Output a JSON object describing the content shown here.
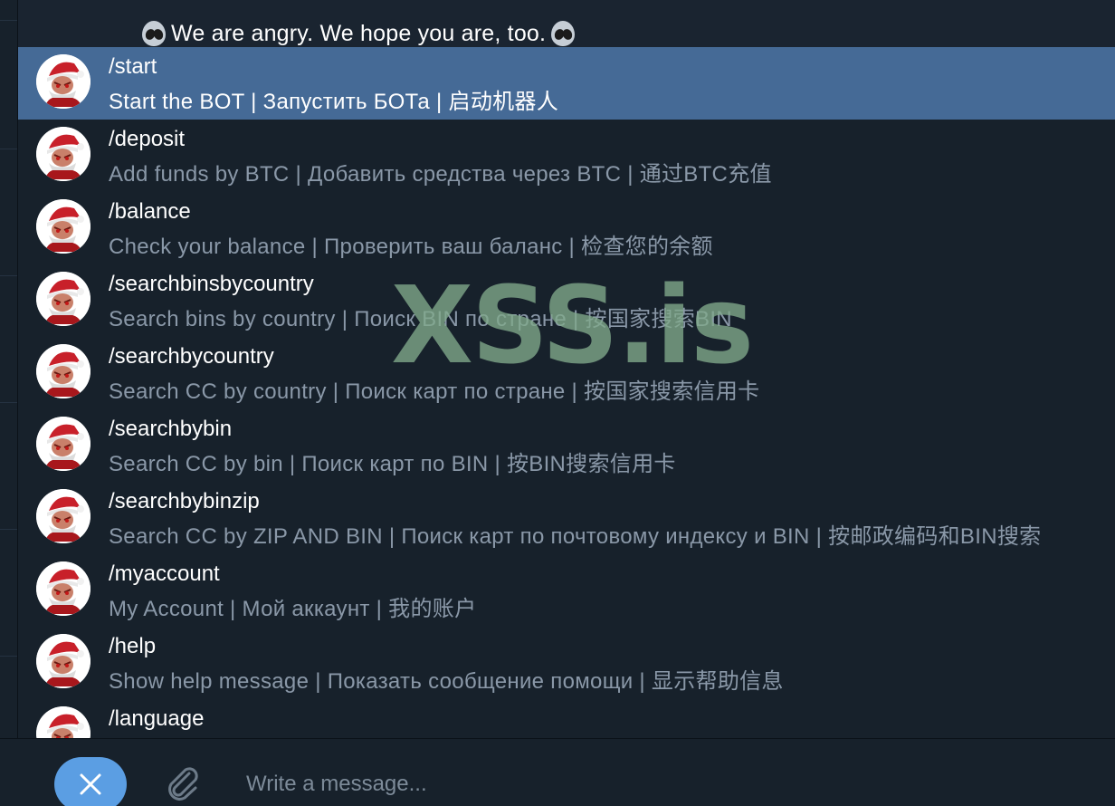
{
  "pinned_message": {
    "text": "We are angry. We hope you are, too.",
    "leading_icon": "alien-icon",
    "trailing_icon": "alien-icon"
  },
  "commands": [
    {
      "name": "/start",
      "description": "Start the BOT | Запустить БОТа | 启动机器人",
      "selected": true
    },
    {
      "name": "/deposit",
      "description": "Add funds by BTC | Добавить средства через BTC | 通过BTC充值",
      "selected": false
    },
    {
      "name": "/balance",
      "description": "Check your balance | Проверить ваш баланс | 检查您的余额",
      "selected": false
    },
    {
      "name": "/searchbinsbycountry",
      "description": "Search bins by country | Поиск BIN по стране | 按国家搜索BIN",
      "selected": false
    },
    {
      "name": "/searchbycountry",
      "description": "Search CC by country | Поиск карт по стране | 按国家搜索信用卡",
      "selected": false
    },
    {
      "name": "/searchbybin",
      "description": "Search CC by bin | Поиск карт по BIN | 按BIN搜索信用卡",
      "selected": false
    },
    {
      "name": "/searchbybinzip",
      "description": "Search CC by ZIP AND BIN | Поиск карт по почтовому индексу и BIN | 按邮政编码和BIN搜索",
      "selected": false
    },
    {
      "name": "/myaccount",
      "description": "My Account | Мой аккаунт | 我的账户",
      "selected": false
    },
    {
      "name": "/help",
      "description": "Show help message | Показать сообщение помощи | 显示帮助信息",
      "selected": false
    },
    {
      "name": "/language",
      "description": "",
      "selected": false
    }
  ],
  "bot_avatar_icon": "santa-avatar-icon",
  "watermark": "XSS.is",
  "composer": {
    "placeholder": "Write a message...",
    "close_icon": "close-icon",
    "attach_icon": "paperclip-icon"
  },
  "colors": {
    "selected_row": "#456a96",
    "list_bg": "#17212b",
    "description_text": "#8a98a8",
    "close_button": "#5b9ee3"
  }
}
